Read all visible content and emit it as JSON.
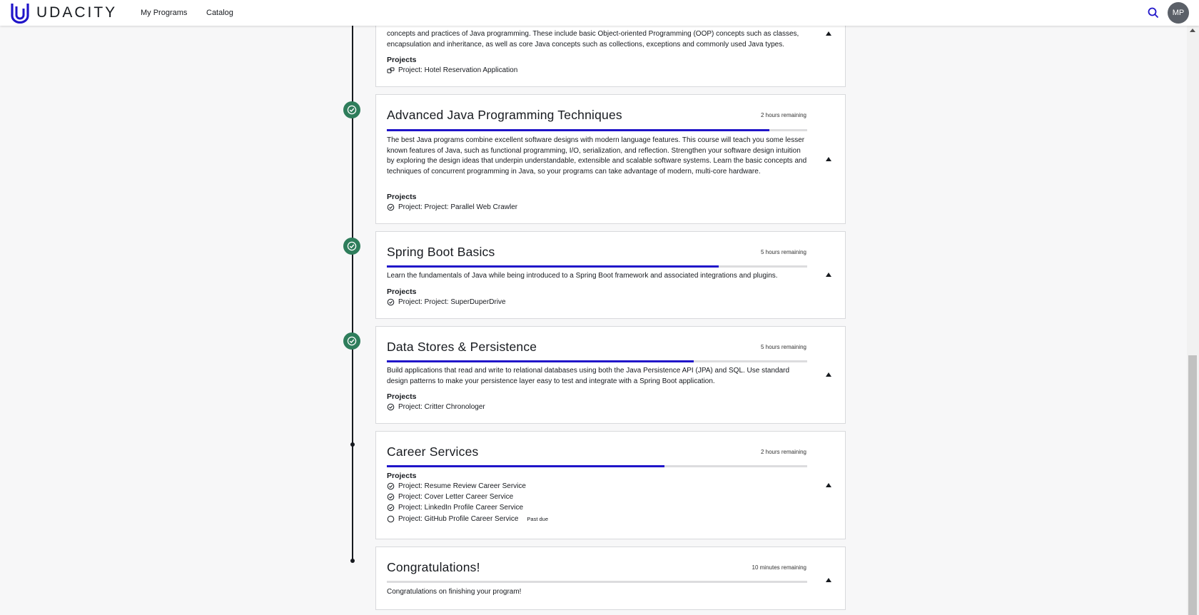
{
  "header": {
    "brand": "UDACITY",
    "nav": [
      "My Programs",
      "Catalog"
    ],
    "avatar_initials": "MP",
    "search_icon": "search-icon"
  },
  "colors": {
    "accent": "#2015c9",
    "complete": "#2e7d5b"
  },
  "courses": [
    {
      "desc": "concepts and practices of Java programming. These include basic Object-oriented Programming (OOP) concepts such as classes, encapsulation and inheritance, as well as core Java concepts such as collections, exceptions and commonly used Java types.",
      "projects_label": "Projects",
      "projects": [
        {
          "name": "Project: Hotel Reservation Application",
          "icon": "project-link-icon"
        }
      ]
    },
    {
      "title": "Advanced Java Programming Techniques",
      "remaining": "2 hours remaining",
      "progress": 0.91,
      "desc": "The best Java programs combine excellent software designs with modern language features. This course will teach you some lesser known features of Java, such as functional programming, I/O, serialization, and reflection. Strengthen your software design intuition by exploring the design ideas that underpin understandable, extensible and scalable software systems. Learn the basic concepts and techniques of concurrent programming in Java, so your programs can take advantage of modern, multi-core hardware.",
      "projects_label": "Projects",
      "projects": [
        {
          "name": "Project: Project: Parallel Web Crawler",
          "icon": "check-circle-icon"
        }
      ]
    },
    {
      "title": "Spring Boot Basics",
      "remaining": "5 hours remaining",
      "progress": 0.79,
      "desc": "Learn the fundamentals of Java while being introduced to a Spring Boot framework and associated integrations and plugins.",
      "projects_label": "Projects",
      "projects": [
        {
          "name": "Project: Project: SuperDuperDrive",
          "icon": "check-circle-icon"
        }
      ]
    },
    {
      "title": "Data Stores & Persistence",
      "remaining": "5 hours remaining",
      "progress": 0.73,
      "desc": "Build applications that read and write to relational databases using both the Java Persistence API (JPA) and SQL. Use standard design patterns to make your persistence layer easy to test and integrate with a Spring Boot application.",
      "projects_label": "Projects",
      "projects": [
        {
          "name": "Project: Critter Chronologer",
          "icon": "check-circle-icon"
        }
      ]
    },
    {
      "title": "Career Services",
      "remaining": "2 hours remaining",
      "progress": 0.66,
      "projects_label": "Projects",
      "projects": [
        {
          "name": "Project: Resume Review Career Service",
          "icon": "check-circle-icon"
        },
        {
          "name": "Project: Cover Letter Career Service",
          "icon": "check-circle-icon"
        },
        {
          "name": "Project: LinkedIn Profile Career Service",
          "icon": "check-circle-icon"
        },
        {
          "name": "Project: GitHub Profile Career Service",
          "icon": "empty-circle-icon",
          "badge": "Past due"
        }
      ]
    },
    {
      "title": "Congratulations!",
      "remaining": "10 minutes remaining",
      "progress": 0.0,
      "desc": "Congratulations on finishing your program!"
    }
  ]
}
